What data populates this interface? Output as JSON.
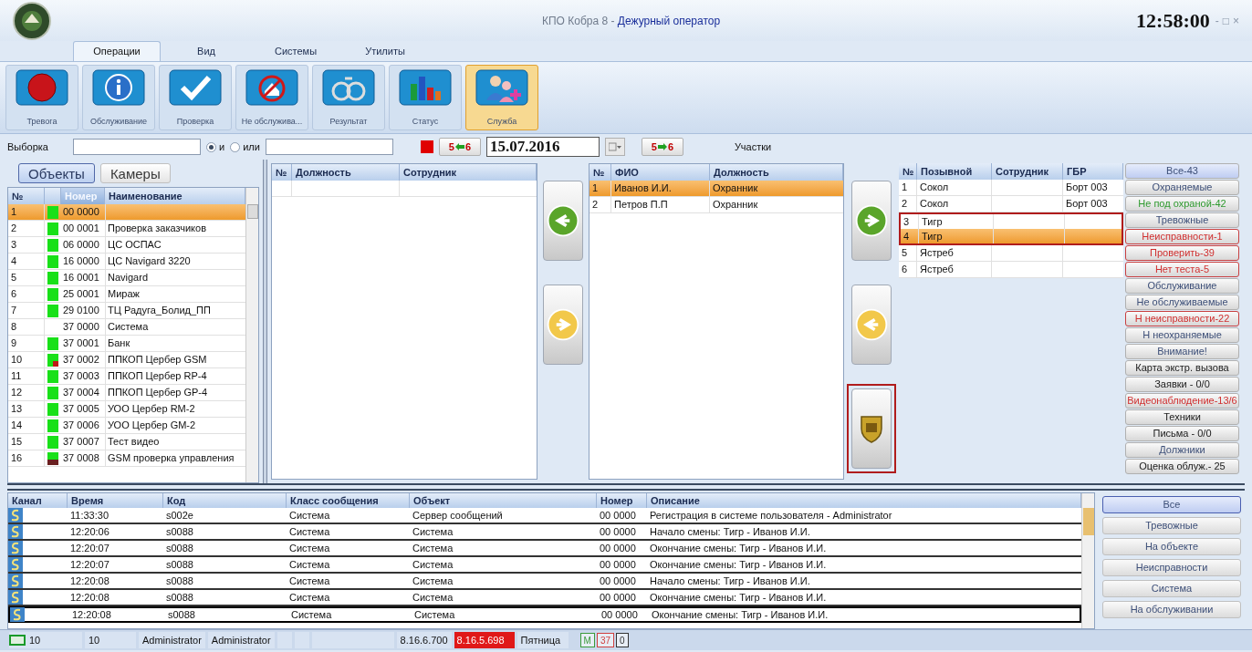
{
  "window": {
    "title_app": "КПО Кобра 8 - ",
    "title_role": "Дежурный оператор",
    "clock": "12:58:00",
    "controls": [
      "-",
      "□",
      "×"
    ]
  },
  "ribbon": {
    "tabs": [
      {
        "label": "Операции",
        "selected": true
      },
      {
        "label": "Вид",
        "selected": false
      },
      {
        "label": "Системы",
        "selected": false
      },
      {
        "label": "Утилиты",
        "selected": false
      }
    ],
    "buttons": [
      {
        "label": "Тревога",
        "selected": false
      },
      {
        "label": "Обслуживание",
        "selected": false
      },
      {
        "label": "Проверка",
        "selected": false
      },
      {
        "label": "Не обслужива...",
        "selected": false
      },
      {
        "label": "Результат",
        "selected": false
      },
      {
        "label": "Статус",
        "selected": false
      },
      {
        "label": "Служба",
        "selected": true
      }
    ]
  },
  "filter": {
    "label": "Выборка",
    "modes": [
      {
        "label": "и",
        "selected": true
      },
      {
        "label": "или",
        "selected": false
      }
    ],
    "prev_day": [
      "5",
      "6"
    ],
    "date": "15.07.2016",
    "next_day": [
      "5",
      "6"
    ],
    "areas_label": "Участки"
  },
  "objects": {
    "tabs": [
      {
        "label": "Объекты",
        "selected": true
      },
      {
        "label": "Камеры",
        "selected": false
      }
    ],
    "columns": [
      "№",
      "Номер",
      "Наименование"
    ],
    "rows": [
      {
        "n": "1",
        "kind": "ok",
        "number": "00 0000",
        "selected": true
      },
      {
        "n": "2",
        "kind": "ok",
        "number": "00 0001",
        "name": "Проверка заказчиков",
        "selected": false
      },
      {
        "n": "3",
        "kind": "ok",
        "number": "06 0000",
        "name": "ЦС ОСПАС",
        "selected": false
      },
      {
        "n": "4",
        "kind": "ok",
        "number": "16 0000",
        "name": "ЦС Navigard 3220",
        "selected": false
      },
      {
        "n": "5",
        "kind": "ok",
        "number": "16 0001",
        "name": "Navigard",
        "selected": false
      },
      {
        "n": "6",
        "kind": "ok",
        "number": "25 0001",
        "name": "Мираж",
        "selected": false
      },
      {
        "n": "7",
        "kind": "ok",
        "number": "29 0100",
        "name": "ТЦ Радуга_Болид_ПП",
        "selected": false
      },
      {
        "n": "8",
        "kind": "none",
        "number": "37 0000",
        "name": "Система",
        "selected": false
      },
      {
        "n": "9",
        "kind": "ok",
        "number": "37 0001",
        "name": "Банк",
        "selected": false
      },
      {
        "n": "10",
        "kind": "fault",
        "number": "37 0002",
        "name": "ППКОП Цербер GSM",
        "selected": false
      },
      {
        "n": "11",
        "kind": "ok",
        "number": "37 0003",
        "name": "ППКОП Цербер RP-4",
        "selected": false
      },
      {
        "n": "12",
        "kind": "ok",
        "number": "37 0004",
        "name": "ППКОП Цербер GP-4",
        "selected": false
      },
      {
        "n": "13",
        "kind": "ok",
        "number": "37 0005",
        "name": "УОО Цербер RM-2",
        "selected": false
      },
      {
        "n": "14",
        "kind": "ok",
        "number": "37 0006",
        "name": "УОО Цербер GM-2",
        "selected": false
      },
      {
        "n": "15",
        "kind": "ok",
        "number": "37 0007",
        "name": "Тест видео",
        "selected": false
      },
      {
        "n": "16",
        "kind": "alarm",
        "number": "37 0008",
        "name": "GSM проверка управления",
        "selected": false
      }
    ]
  },
  "positions": {
    "columns": [
      "№",
      "Должность",
      "Сотрудник"
    ]
  },
  "staff": {
    "columns": [
      "№",
      "ФИО",
      "Должность"
    ],
    "rows": [
      {
        "n": "1",
        "name": "Иванов И.И.",
        "role": "Охранник",
        "selected": true
      },
      {
        "n": "2",
        "name": "Петров П.П",
        "role": "Охранник",
        "selected": false
      }
    ]
  },
  "crew_actions": {
    "shield_highlighted": true
  },
  "crews": {
    "columns": [
      "№",
      "Позывной",
      "Сотрудник",
      "ГБР"
    ],
    "rows": [
      {
        "n": "1",
        "callsign": "Сокол",
        "unit": "Борт 003",
        "selected": false,
        "highlighted": false
      },
      {
        "n": "2",
        "callsign": "Сокол",
        "unit": "Борт 003",
        "selected": false,
        "highlighted": false
      },
      {
        "n": "3",
        "callsign": "Тигр",
        "selected": false,
        "highlighted": true
      },
      {
        "n": "4",
        "callsign": "Тигр",
        "selected": true,
        "highlighted": true
      },
      {
        "n": "5",
        "callsign": "Ястреб",
        "selected": false,
        "highlighted": false
      },
      {
        "n": "6",
        "callsign": "Ястреб",
        "selected": false,
        "highlighted": false
      }
    ]
  },
  "filters": [
    {
      "label": "Все-43",
      "kind": "muted",
      "selected": true
    },
    {
      "label": "Охраняемые",
      "kind": "muted",
      "selected": false
    },
    {
      "label": "Не под охраной-42",
      "kind": "ok",
      "selected": false
    },
    {
      "label": "Тревожные",
      "kind": "muted",
      "selected": false
    },
    {
      "label": "Неисправности-1",
      "kind": "alert",
      "selected": false
    },
    {
      "label": "Проверить-39",
      "kind": "alert",
      "selected": false
    },
    {
      "label": "Нет теста-5",
      "kind": "alert",
      "selected": false
    },
    {
      "label": "Обслуживание",
      "kind": "muted",
      "selected": false
    },
    {
      "label": "Не обслуживаемые",
      "kind": "muted",
      "selected": false
    },
    {
      "label": "Н неисправности-22",
      "kind": "alert",
      "selected": false
    },
    {
      "label": "Н неохраняемые",
      "kind": "muted",
      "selected": false
    },
    {
      "label": "Внимание!",
      "kind": "muted",
      "selected": false
    },
    {
      "label": "Карта экстр. вызова",
      "kind": "strong",
      "selected": false
    },
    {
      "label": "Заявки - 0/0",
      "kind": "strong",
      "selected": false
    },
    {
      "label": "Видеонаблюдение-13/6",
      "kind": "warn",
      "selected": false
    },
    {
      "label": "Техники",
      "kind": "strong",
      "selected": false
    },
    {
      "label": "Письма - 0/0",
      "kind": "strong",
      "selected": false
    },
    {
      "label": "Должники",
      "kind": "muted",
      "selected": false
    },
    {
      "label": "Оценка облуж.- 25",
      "kind": "strong",
      "selected": false
    }
  ],
  "log": {
    "columns": [
      "Канал",
      "Время",
      "Код",
      "Класс сообщения",
      "Объект",
      "Номер",
      "Описание"
    ],
    "rows": [
      {
        "time": "11:33:30",
        "code": "s002e",
        "class": "Система",
        "object": "Сервер сообщений",
        "number": "00 0000",
        "description": "Регистрация в системе пользователя - Administrator",
        "focused": false
      },
      {
        "time": "12:20:06",
        "code": "s0088",
        "class": "Система",
        "object": "Система",
        "number": "00 0000",
        "description": "Начало смены: Тигр - Иванов И.И.",
        "focused": false
      },
      {
        "time": "12:20:07",
        "code": "s0088",
        "class": "Система",
        "object": "Система",
        "number": "00 0000",
        "description": "Окончание смены: Тигр - Иванов И.И.",
        "focused": false
      },
      {
        "time": "12:20:07",
        "code": "s0088",
        "class": "Система",
        "object": "Система",
        "number": "00 0000",
        "description": "Окончание смены: Тигр - Иванов И.И.",
        "focused": false
      },
      {
        "time": "12:20:08",
        "code": "s0088",
        "class": "Система",
        "object": "Система",
        "number": "00 0000",
        "description": "Начало смены: Тигр - Иванов И.И.",
        "focused": false
      },
      {
        "time": "12:20:08",
        "code": "s0088",
        "class": "Система",
        "object": "Система",
        "number": "00 0000",
        "description": "Окончание смены: Тигр - Иванов И.И.",
        "focused": false
      },
      {
        "time": "12:20:08",
        "code": "s0088",
        "class": "Система",
        "object": "Система",
        "number": "00 0000",
        "description": "Окончание смены: Тигр - Иванов И.И.",
        "focused": true
      }
    ]
  },
  "log_filters": [
    {
      "label": "Все",
      "selected": true
    },
    {
      "label": "Тревожные",
      "selected": false
    },
    {
      "label": "На объекте",
      "selected": false
    },
    {
      "label": "Неисправности",
      "selected": false
    },
    {
      "label": "Система",
      "selected": false
    },
    {
      "label": "На обслуживании",
      "selected": false
    }
  ],
  "status_bar": {
    "cells": [
      {
        "kind": "channel",
        "text": "10"
      },
      {
        "kind": "plain",
        "text": "10"
      },
      {
        "kind": "plain",
        "text": "Administrator"
      },
      {
        "kind": "plain",
        "text": "Administrator"
      },
      {
        "kind": "blank"
      },
      {
        "kind": "blank"
      },
      {
        "kind": "wide"
      },
      {
        "kind": "plain",
        "text": "8.16.6.700"
      },
      {
        "kind": "alert",
        "text": "8.16.5.698"
      },
      {
        "kind": "plain",
        "text": "Пятница"
      }
    ],
    "badges": [
      {
        "text": "M",
        "color": "#3a9a3a"
      },
      {
        "text": "37",
        "color": "#d04040"
      },
      {
        "text": "0",
        "color": "#333333"
      }
    ]
  }
}
